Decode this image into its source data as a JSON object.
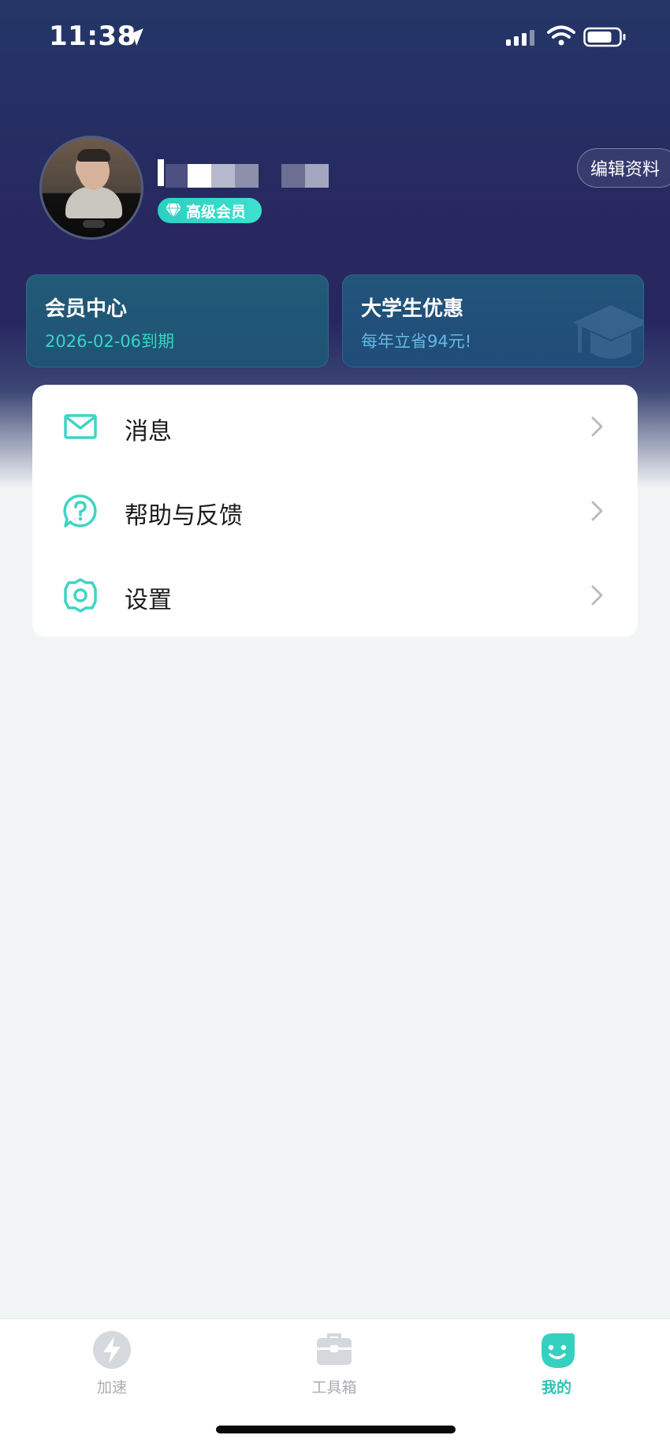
{
  "status_bar": {
    "time": "11:38",
    "icons": [
      "location-arrow-icon",
      "signal-icon",
      "wifi-icon",
      "battery-icon"
    ]
  },
  "profile": {
    "avatar_icon": "avatar-photo",
    "badge_label": "高级会员",
    "badge_icon": "diamond-icon",
    "edit_label": "编辑资料"
  },
  "cards": {
    "member": {
      "title": "会员中心",
      "subtitle": "2026-02-06到期"
    },
    "student": {
      "title": "大学生优惠",
      "subtitle": "每年立省94元!",
      "icon": "graduation-cap-icon"
    }
  },
  "menu": {
    "items": [
      {
        "label": "消息",
        "icon": "mail-icon"
      },
      {
        "label": "帮助与反馈",
        "icon": "help-bubble-icon"
      },
      {
        "label": "设置",
        "icon": "settings-gear-icon"
      }
    ]
  },
  "tabbar": {
    "tabs": [
      {
        "label": "加速",
        "icon": "lightning-icon",
        "active": false
      },
      {
        "label": "工具箱",
        "icon": "toolbox-icon",
        "active": false
      },
      {
        "label": "我的",
        "icon": "smile-face-icon",
        "active": true
      }
    ]
  },
  "colors": {
    "accent": "#2ec2b4",
    "hero_top": "#243667",
    "hero_mid": "#28275f",
    "background": "#f2f5f6",
    "card_member_sub": "#36d6c3",
    "card_student_sub": "#64b7e6"
  }
}
